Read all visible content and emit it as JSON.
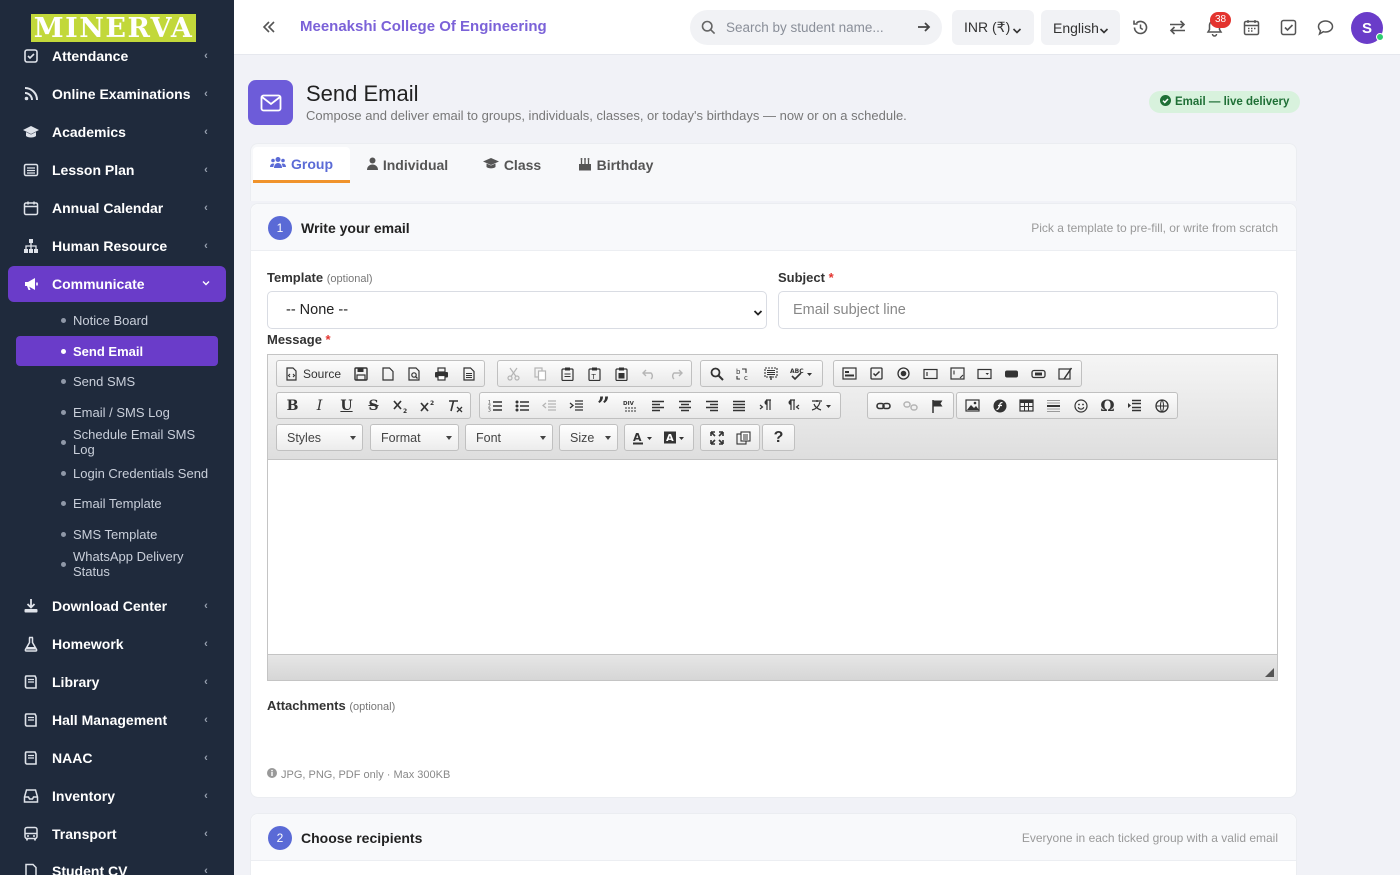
{
  "sidebar": {
    "logo": "MINERVA",
    "items": [
      {
        "label": "Attendance",
        "icon": "checkbox-icon"
      },
      {
        "label": "Online Examinations",
        "icon": "rss-icon"
      },
      {
        "label": "Academics",
        "icon": "graduation-cap-icon"
      },
      {
        "label": "Lesson Plan",
        "icon": "list-alt-icon"
      },
      {
        "label": "Annual Calendar",
        "icon": "calendar-icon"
      },
      {
        "label": "Human Resource",
        "icon": "sitemap-icon"
      },
      {
        "label": "Communicate",
        "icon": "bullhorn-icon"
      },
      {
        "label": "Download Center",
        "icon": "download-icon"
      },
      {
        "label": "Homework",
        "icon": "flask-icon"
      },
      {
        "label": "Library",
        "icon": "book-icon"
      },
      {
        "label": "Hall Management",
        "icon": "book-icon"
      },
      {
        "label": "NAAC",
        "icon": "book-icon"
      },
      {
        "label": "Inventory",
        "icon": "inbox-icon"
      },
      {
        "label": "Transport",
        "icon": "bus-icon"
      },
      {
        "label": "Student CV",
        "icon": "file-icon"
      }
    ],
    "sub_items": [
      {
        "label": "Notice Board"
      },
      {
        "label": "Send Email"
      },
      {
        "label": "Send SMS"
      },
      {
        "label": "Email / SMS Log"
      },
      {
        "label": "Schedule Email SMS Log"
      },
      {
        "label": "Login Credentials Send"
      },
      {
        "label": "Email Template"
      },
      {
        "label": "SMS Template"
      },
      {
        "label": "WhatsApp Delivery Status"
      }
    ]
  },
  "header": {
    "college": "Meenakshi College Of Engineering",
    "search_placeholder": "Search by student name...",
    "currency": "INR (₹)",
    "language": "English",
    "notification_count": "38",
    "avatar_initial": "S"
  },
  "page": {
    "title": "Send Email",
    "subtitle": "Compose and deliver email to groups, individuals, classes, or today's birthdays — now or on a schedule.",
    "badge": "Email — live delivery",
    "tabs": [
      {
        "label": "Group",
        "icon": "users-icon"
      },
      {
        "label": "Individual",
        "icon": "user-icon"
      },
      {
        "label": "Class",
        "icon": "graduation-cap-icon"
      },
      {
        "label": "Birthday",
        "icon": "birthday-cake-icon"
      }
    ]
  },
  "step1": {
    "number": "1",
    "title": "Write your email",
    "hint": "Pick a template to pre-fill, or write from scratch",
    "template_label": "Template",
    "optional": "(optional)",
    "template_value": "-- None --",
    "subject_label": "Subject",
    "required_mark": "*",
    "subject_placeholder": "Email subject line",
    "message_label": "Message",
    "source_label": "Source",
    "combos": [
      "Styles",
      "Format",
      "Font",
      "Size"
    ],
    "attachments_label": "Attachments",
    "attachments_hint": "JPG, PNG, PDF only · Max 300KB"
  },
  "step2": {
    "number": "2",
    "title": "Choose recipients",
    "hint": "Everyone in each ticked group with a valid email"
  },
  "colors": {
    "sidebar_bg": "#1f2a3c",
    "accent": "#6a3cc9",
    "tab_active": "#5b6bd6",
    "tab_underline": "#f0932b",
    "badge_bg": "#d8f2dd"
  }
}
